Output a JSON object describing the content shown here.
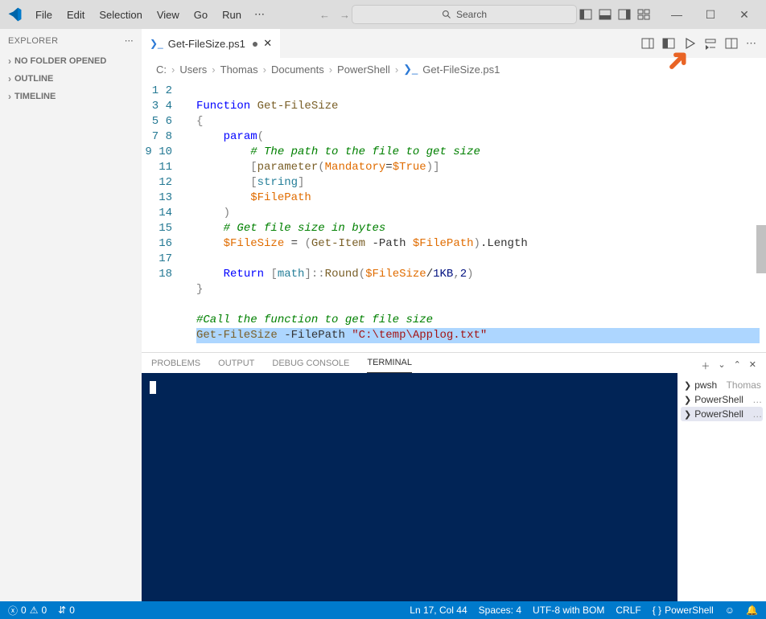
{
  "menu": {
    "items": [
      "File",
      "Edit",
      "Selection",
      "View",
      "Go",
      "Run"
    ],
    "ellipsis": "⋯"
  },
  "search": {
    "placeholder": "Search"
  },
  "explorer": {
    "title": "EXPLORER",
    "sections": [
      "NO FOLDER OPENED",
      "OUTLINE",
      "TIMELINE"
    ]
  },
  "tab": {
    "name": "Get-FileSize.ps1"
  },
  "breadcrumbs": [
    "C:",
    "Users",
    "Thomas",
    "Documents",
    "PowerShell",
    "Get-FileSize.ps1"
  ],
  "code": {
    "lines": {
      "l1": "",
      "l2_kw": "Function",
      "l2_name": "Get-FileSize",
      "l3": "{",
      "l4_kw": "param",
      "l4_paren": "(",
      "l5": "# The path to the file to get size",
      "l6_pname": "parameter",
      "l6_arg": "Mandatory",
      "l6_val": "$True",
      "l7": "string",
      "l8": "$FilePath",
      "l9": ")",
      "l10": "# Get file size in bytes",
      "l11_v": "$FileSize",
      "l11_fn": "Get-Item",
      "l11_p": "-Path",
      "l11_a": "$FilePath",
      "l11_m": ".Length",
      "l13_kw": "Return",
      "l13_t": "math",
      "l13_fn": "Round",
      "l13_v": "$FileSize",
      "l13_d": "1KB",
      "l13_n": "2",
      "l14": "}",
      "l16": "#Call the function to get file size",
      "l17_fn": "Get-FileSize",
      "l17_p": "-FilePath",
      "l17_s": "\"C:\\temp\\Applog.txt\""
    }
  },
  "panel": {
    "tabs": [
      "PROBLEMS",
      "OUTPUT",
      "DEBUG CONSOLE",
      "TERMINAL"
    ],
    "terminals": [
      {
        "icon": "❯",
        "label": "pwsh",
        "extra": "Thomas"
      },
      {
        "icon": "❯",
        "label": "PowerShell",
        "extra": "…"
      },
      {
        "icon": "❯",
        "label": "PowerShell",
        "extra": "…"
      }
    ]
  },
  "status": {
    "errors": "0",
    "warnings": "0",
    "ports": "0",
    "lncol": "Ln 17, Col 44",
    "spaces": "Spaces: 4",
    "encoding": "UTF-8 with BOM",
    "eol": "CRLF",
    "lang": "PowerShell"
  }
}
